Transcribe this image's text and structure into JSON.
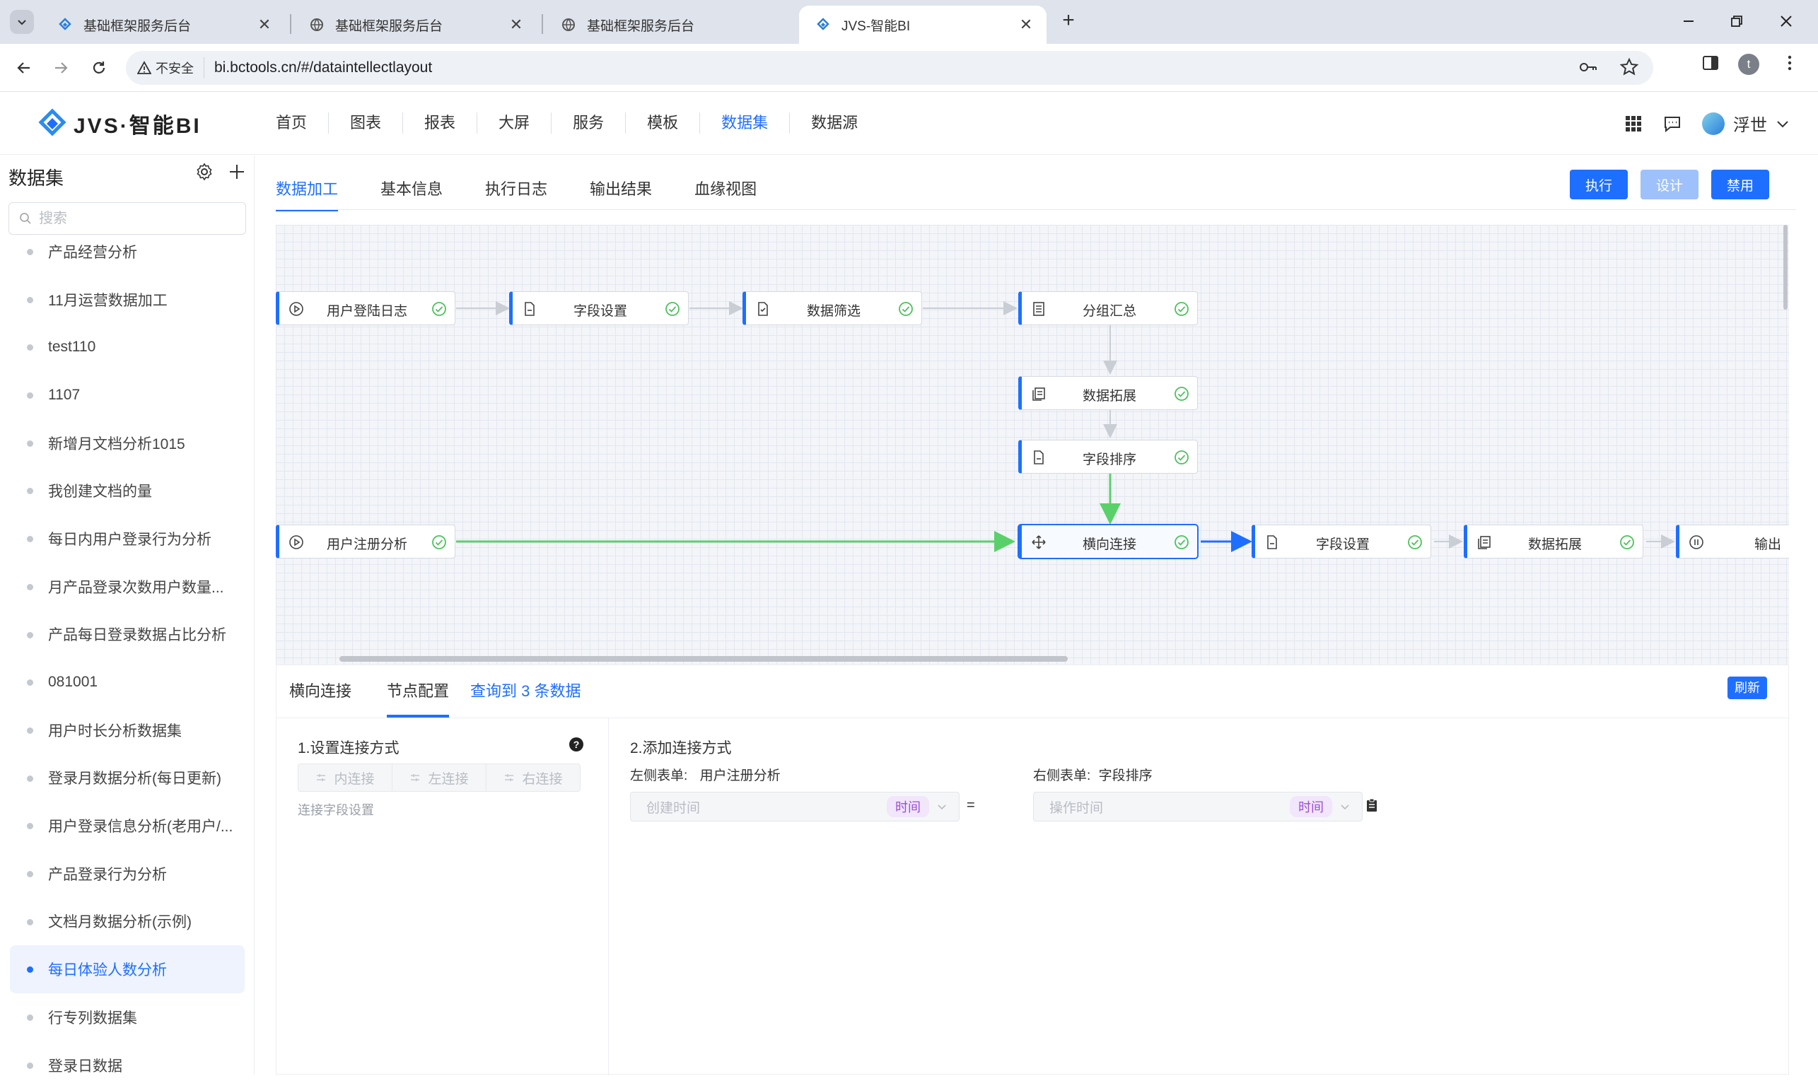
{
  "browser": {
    "tabs": [
      {
        "label": "基础框架服务后台",
        "icon": "app-diamond-icon",
        "active": false
      },
      {
        "label": "基础框架服务后台",
        "icon": "globe-icon",
        "active": false
      },
      {
        "label": "基础框架服务后台",
        "icon": "globe-icon",
        "active": false
      },
      {
        "label": "JVS-智能BI",
        "icon": "app-diamond-icon",
        "active": true
      }
    ],
    "security_label": "不安全",
    "url": "bi.bctools.cn/#/dataintellectlayout",
    "profile_initial": "t"
  },
  "app": {
    "logo_text": "JVS·智能BI",
    "nav": [
      {
        "label": "首页",
        "active": false
      },
      {
        "label": "图表",
        "active": false
      },
      {
        "label": "报表",
        "active": false
      },
      {
        "label": "大屏",
        "active": false
      },
      {
        "label": "服务",
        "active": false
      },
      {
        "label": "模板",
        "active": false
      },
      {
        "label": "数据集",
        "active": true
      },
      {
        "label": "数据源",
        "active": false
      }
    ],
    "username": "浮世",
    "accent_color": "#1e6fff"
  },
  "sidebar": {
    "title": "数据集",
    "search_placeholder": "搜索",
    "items": [
      {
        "label": "产品经营分析",
        "active": false
      },
      {
        "label": "11月运营数据加工",
        "active": false
      },
      {
        "label": "test110",
        "active": false
      },
      {
        "label": "1107",
        "active": false
      },
      {
        "label": "新增月文档分析1015",
        "active": false
      },
      {
        "label": "我创建文档的量",
        "active": false
      },
      {
        "label": "每日内用户登录行为分析",
        "active": false
      },
      {
        "label": "月产品登录次数用户数量...",
        "active": false
      },
      {
        "label": "产品每日登录数据占比分析",
        "active": false
      },
      {
        "label": "081001",
        "active": false
      },
      {
        "label": "用户时长分析数据集",
        "active": false
      },
      {
        "label": "登录月数据分析(每日更新)",
        "active": false
      },
      {
        "label": "用户登录信息分析(老用户/...",
        "active": false
      },
      {
        "label": "产品登录行为分析",
        "active": false
      },
      {
        "label": "文档月数据分析(示例)",
        "active": false
      },
      {
        "label": "每日体验人数分析",
        "active": true
      },
      {
        "label": "行专列数据集",
        "active": false
      },
      {
        "label": "登录日数据",
        "active": false
      }
    ]
  },
  "main": {
    "tabs": [
      {
        "label": "数据加工",
        "active": true
      },
      {
        "label": "基本信息",
        "active": false
      },
      {
        "label": "执行日志",
        "active": false
      },
      {
        "label": "输出结果",
        "active": false
      },
      {
        "label": "血缘视图",
        "active": false
      }
    ],
    "actions": {
      "execute": "执行",
      "design": "设计",
      "disable": "禁用"
    },
    "flow_nodes": [
      {
        "id": "n1",
        "label": "用户登陆日志",
        "icon": "play-circle-icon",
        "status": "ok"
      },
      {
        "id": "n2",
        "label": "字段设置",
        "icon": "document-icon",
        "status": "ok"
      },
      {
        "id": "n3",
        "label": "数据筛选",
        "icon": "filter-doc-icon",
        "status": "ok"
      },
      {
        "id": "n4",
        "label": "分组汇总",
        "icon": "list-doc-icon",
        "status": "ok"
      },
      {
        "id": "n5",
        "label": "数据拓展",
        "icon": "copy-doc-icon",
        "status": "ok"
      },
      {
        "id": "n6",
        "label": "字段排序",
        "icon": "document-icon",
        "status": "ok"
      },
      {
        "id": "n7",
        "label": "用户注册分析",
        "icon": "play-circle-icon",
        "status": "ok"
      },
      {
        "id": "n8",
        "label": "横向连接",
        "icon": "move-cross-icon",
        "status": "ok",
        "selected": true
      },
      {
        "id": "n9",
        "label": "字段设置",
        "icon": "document-icon",
        "status": "ok"
      },
      {
        "id": "n10",
        "label": "数据拓展",
        "icon": "copy-doc-icon",
        "status": "ok"
      },
      {
        "id": "n11",
        "label": "输出",
        "icon": "pause-circle-icon",
        "status": "none"
      }
    ],
    "bottom": {
      "tabs": [
        {
          "label": "横向连接",
          "active": false
        },
        {
          "label": "节点配置",
          "active": true
        }
      ],
      "query_result": "查询到 3 条数据",
      "refresh": "刷新",
      "left": {
        "section_title": "1.设置连接方式",
        "join_types": [
          "内连接",
          "左连接",
          "右连接"
        ],
        "sub_label": "连接字段设置"
      },
      "right": {
        "section_title": "2.添加连接方式",
        "left_table_label": "左侧表单:",
        "left_table_name": "用户注册分析",
        "right_table_label": "右侧表单:",
        "right_table_name": "字段排序",
        "left_field_placeholder": "创建时间",
        "left_field_type": "时间",
        "right_field_placeholder": "操作时间",
        "right_field_type": "时间",
        "equals": "="
      }
    }
  }
}
